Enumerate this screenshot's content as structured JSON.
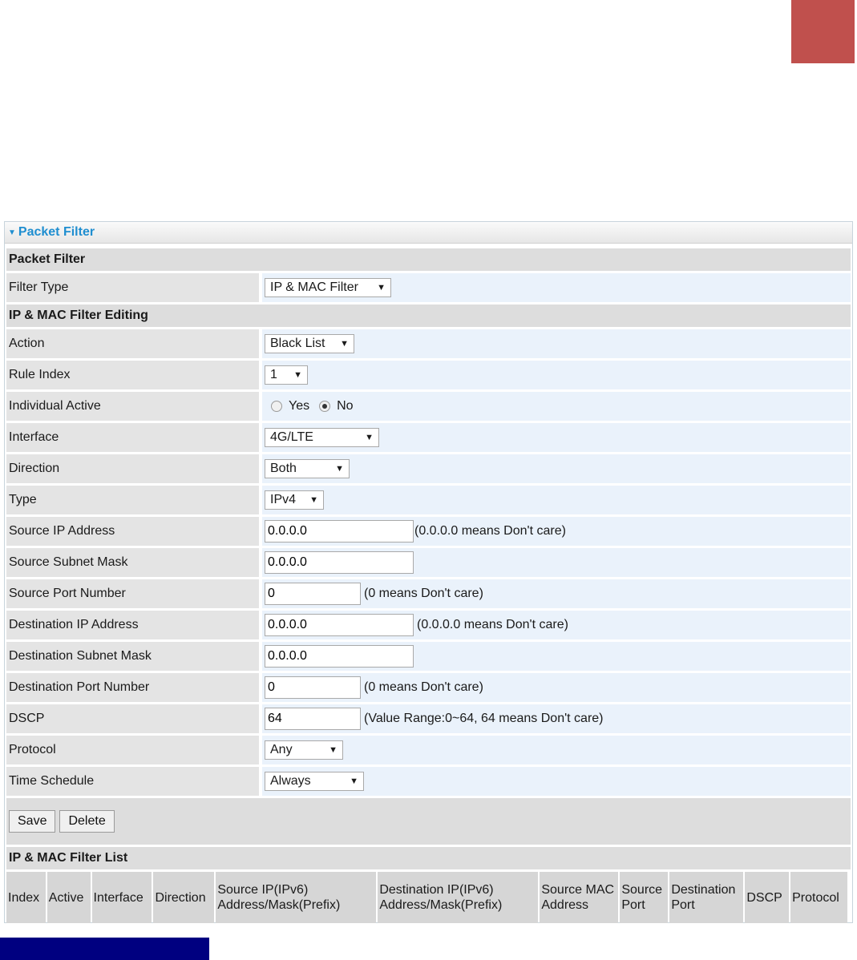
{
  "header": {
    "title": "Packet Filter"
  },
  "sections": {
    "packet_filter": "Packet Filter",
    "editing": "IP & MAC Filter Editing",
    "list": "IP & MAC Filter List"
  },
  "fields": {
    "filter_type": {
      "label": "Filter Type",
      "value": "IP & MAC Filter"
    },
    "action": {
      "label": "Action",
      "value": "Black List"
    },
    "rule_index": {
      "label": "Rule Index",
      "value": "1"
    },
    "individual_active": {
      "label": "Individual Active",
      "yes": "Yes",
      "no": "No",
      "selected": "No"
    },
    "interface": {
      "label": "Interface",
      "value": "4G/LTE"
    },
    "direction": {
      "label": "Direction",
      "value": "Both"
    },
    "type": {
      "label": "Type",
      "value": "IPv4"
    },
    "source_ip": {
      "label": "Source IP Address",
      "value": "0.0.0.0",
      "hint": "(0.0.0.0 means Don't care)"
    },
    "source_mask": {
      "label": "Source Subnet Mask",
      "value": "0.0.0.0"
    },
    "source_port": {
      "label": "Source Port Number",
      "value": "0",
      "hint": "(0 means Don't care)"
    },
    "dest_ip": {
      "label": "Destination IP Address",
      "value": "0.0.0.0",
      "hint": "(0.0.0.0 means Don't care)"
    },
    "dest_mask": {
      "label": "Destination Subnet Mask",
      "value": "0.0.0.0"
    },
    "dest_port": {
      "label": "Destination Port Number",
      "value": "0",
      "hint": "(0 means Don't care)"
    },
    "dscp": {
      "label": "DSCP",
      "value": "64",
      "hint": "(Value Range:0~64, 64 means Don't care)"
    },
    "protocol": {
      "label": "Protocol",
      "value": "Any"
    },
    "time_schedule": {
      "label": "Time Schedule",
      "value": "Always"
    }
  },
  "buttons": {
    "save": "Save",
    "delete": "Delete"
  },
  "list_columns": [
    "Index",
    "Active",
    "Interface",
    "Direction",
    "Source IP(IPv6) Address/Mask(Prefix)",
    "Destination IP(IPv6) Address/Mask(Prefix)",
    "Source MAC Address",
    "Source Port",
    "Destination Port",
    "DSCP",
    "Protocol"
  ],
  "colors": {
    "accent": "#1f8ed0",
    "corner_block": "#c0504d",
    "bottom_bar": "#000080"
  }
}
